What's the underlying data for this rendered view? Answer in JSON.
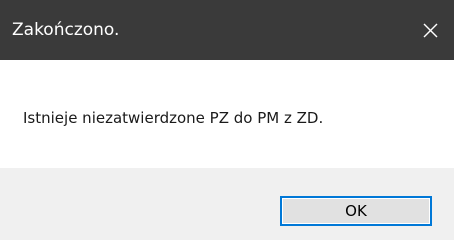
{
  "dialog": {
    "title": "Zakończono.",
    "message": "Istnieje niezatwierdzone PZ do PM z ZD.",
    "ok_label": "OK",
    "close_icon": "close-icon"
  },
  "colors": {
    "title_bar": "#3a3a3a",
    "title_text": "#ffffff",
    "content_bg": "#ffffff",
    "footer_bg": "#f0f0f0",
    "button_border": "#0078d7",
    "button_bg": "#e1e1e1"
  }
}
